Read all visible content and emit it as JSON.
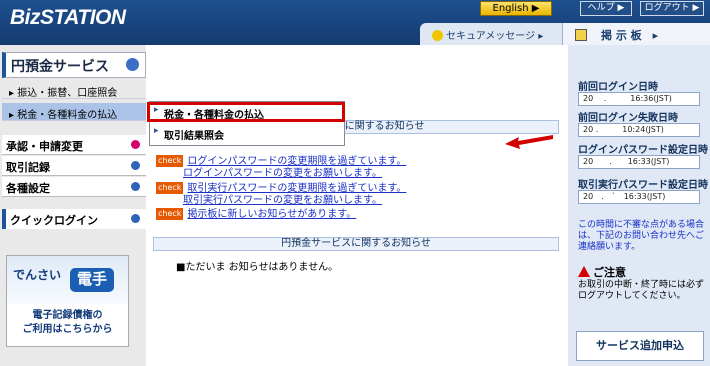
{
  "header": {
    "logo": "BizSTATION",
    "english_label": "English ▶",
    "help_label": "ヘルプ ▶",
    "logout_label": "ログアウト ▶",
    "secure_message": "セキュアメッセージ ▸",
    "board_label": "掲 示 板　▸"
  },
  "sidebar": {
    "section_title": "円預金サービス",
    "sub_items": [
      {
        "label": "▸ 振込・振替、口座照会",
        "selected": false
      },
      {
        "label": "▸ 税金・各種料金の払込",
        "selected": true
      }
    ],
    "menus": [
      {
        "label": "承認・申請変更",
        "dot_color": "#d4006a"
      },
      {
        "label": "取引記録",
        "dot_color": "#2d64b5"
      },
      {
        "label": "各種設定",
        "dot_color": "#2d64b5"
      }
    ],
    "quick_login": "クイックログイン",
    "densai": {
      "logo_text": "でんさい",
      "logo_mark": "電手",
      "line1": "電子記録債権の",
      "line2": "ご利用はこちらから"
    }
  },
  "dropdown": {
    "items": [
      {
        "label": "税金・各種料金の払込"
      },
      {
        "label": "取引結果照会"
      }
    ]
  },
  "main": {
    "biz_notice_header": "BizSTATIONに関するお知らせ",
    "check_label": "check",
    "notices": [
      {
        "line1": "ログインパスワードの変更期限を過ぎています。",
        "line2": "ログインパスワードの変更をお願いします。"
      },
      {
        "line1": "取引実行パスワードの変更期限を過ぎています。",
        "line2": "取引実行パスワードの変更をお願いします。"
      },
      {
        "line1": "掲示板に新しいお知らせがあります。",
        "line2": ""
      }
    ],
    "yen_notice_header": "円預金サービスに関するお知らせ",
    "no_notice": "■ただいま お知らせはありません。"
  },
  "right_panel": {
    "entries": [
      {
        "label": "前回ログイン日時",
        "value": "20　 .　　　16:36(JST)"
      },
      {
        "label": "前回ログイン失敗日時",
        "value": "20 .　　　10:24(JST)"
      },
      {
        "label": "ログインパスワード設定日時",
        "value": "20　　.　　16:33(JST)"
      },
      {
        "label": "取引実行パスワード設定日時",
        "value": "20　.　`　16:33(JST)"
      }
    ],
    "info_text": "この時間に不審な点がある場合は、下記のお問い合わせ先へご連絡願います。",
    "caution_title": "ご注意",
    "caution_text": "お取引の中断・終了時には必ずログアウトしてください。",
    "service_add": "サービス追加申込"
  },
  "colors": {
    "header_blue": "#1d4f8e",
    "highlight_red": "#d30000",
    "check_orange": "#e55a00",
    "link_blue": "#1a30c8"
  }
}
